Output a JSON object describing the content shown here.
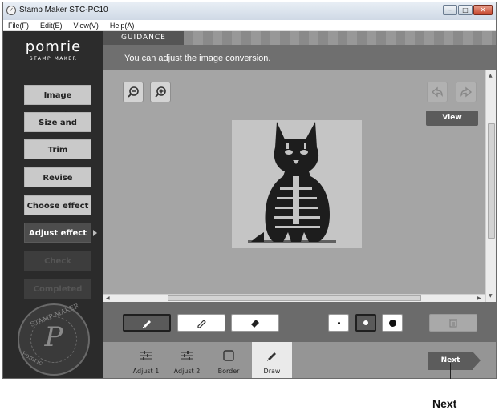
{
  "window": {
    "title": "Stamp Maker STC-PC10",
    "controls": [
      "minimize-icon",
      "maximize-icon",
      "close-icon"
    ]
  },
  "menu": [
    "File(F)",
    "Edit(E)",
    "View(V)",
    "Help(A)"
  ],
  "header": {
    "logo": "pomrie",
    "logo_sub": "STAMP MAKER",
    "guidance_label": "GUIDANCE",
    "guidance_message": "You can adjust the image conversion."
  },
  "steps": [
    {
      "label": "Image selection",
      "state": "normal"
    },
    {
      "label": "Size and position",
      "state": "normal"
    },
    {
      "label": "Trim",
      "state": "normal"
    },
    {
      "label": "Revise",
      "state": "normal"
    },
    {
      "label": "Choose effect",
      "state": "normal"
    },
    {
      "label": "Adjust effect",
      "state": "active"
    },
    {
      "label": "Check",
      "state": "disabled"
    },
    {
      "label": "Completed",
      "state": "disabled"
    }
  ],
  "seal": {
    "letter": "P",
    "top_text": "STAMP MAKER",
    "bottom_text": "Pomric"
  },
  "canvas": {
    "view_label": "View",
    "tools": [
      "zoom-out-icon",
      "zoom-in-icon",
      "undo-icon",
      "redo-icon"
    ]
  },
  "toolrow": {
    "tools": [
      "brush-icon",
      "pencil-icon",
      "eraser-icon"
    ],
    "active_tool": "brush-icon",
    "sizes": [
      "small",
      "medium",
      "large"
    ],
    "active_size": "medium"
  },
  "bottom_tabs": [
    {
      "label": "Adjust 1",
      "icon": "sliders-icon"
    },
    {
      "label": "Adjust 2",
      "icon": "sliders-icon"
    },
    {
      "label": "Border",
      "icon": "border-icon"
    },
    {
      "label": "Draw",
      "icon": "pen-icon"
    }
  ],
  "active_bottom_tab": "Draw",
  "next_label": "Next",
  "callout": {
    "label": "Next"
  }
}
